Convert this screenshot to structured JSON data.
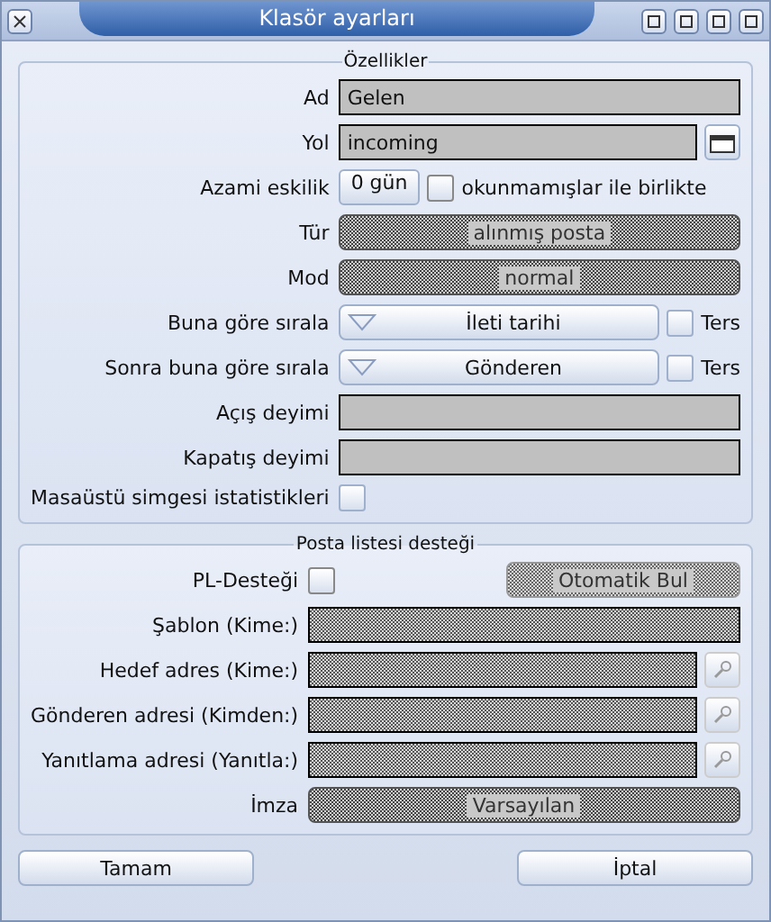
{
  "window": {
    "title": "Klasör ayarları"
  },
  "properties": {
    "title": "Özellikler",
    "rows": [
      {
        "kind": "text",
        "label": "Ad",
        "value": "Gelen",
        "disabled": false
      },
      {
        "kind": "path",
        "label": "Yol",
        "value": "incoming",
        "disabled": false
      },
      {
        "kind": "age",
        "label": "Azami eskilik",
        "value": "0 gün",
        "check_label": "okunmamışlar ile birlikte",
        "checked": false,
        "disabled": true
      },
      {
        "kind": "combo",
        "label": "Tür",
        "value": "alınmış posta",
        "disabled": true
      },
      {
        "kind": "combo",
        "label": "Mod",
        "value": "normal",
        "disabled": true
      },
      {
        "kind": "sort",
        "label": "Buna göre sırala",
        "value": "İleti tarihi",
        "check_label": "Ters",
        "checked": false,
        "disabled": false
      },
      {
        "kind": "sort",
        "label": "Sonra buna göre sırala",
        "value": "Gönderen",
        "check_label": "Ters",
        "checked": false,
        "disabled": false
      },
      {
        "kind": "text",
        "label": "Açış deyimi",
        "value": "",
        "disabled": false
      },
      {
        "kind": "text",
        "label": "Kapatış deyimi",
        "value": "",
        "disabled": false
      },
      {
        "kind": "check",
        "label": "Masaüstü simgesi istatistikleri",
        "checked": false,
        "disabled": false
      }
    ]
  },
  "mailing_list": {
    "title": "Posta listesi desteği",
    "rows": [
      {
        "kind": "check_button",
        "label": "PL-Desteği",
        "checked": false,
        "disabled": true,
        "button": "Otomatik Bul"
      },
      {
        "kind": "text",
        "label": "Şablon (Kime:)",
        "value": "",
        "disabled": true
      },
      {
        "kind": "path",
        "label": "Hedef adres (Kime:)",
        "value": "",
        "disabled": true
      },
      {
        "kind": "path",
        "label": "Gönderen adresi (Kimden:)",
        "value": "",
        "disabled": true
      },
      {
        "kind": "path",
        "label": "Yanıtlama adresi (Yanıtla:)",
        "value": "",
        "disabled": true
      },
      {
        "kind": "combo",
        "label": "İmza",
        "value": "Varsayılan",
        "disabled": true
      }
    ]
  },
  "buttons": [
    {
      "label": "Tamam"
    },
    {
      "label": "İptal"
    }
  ]
}
